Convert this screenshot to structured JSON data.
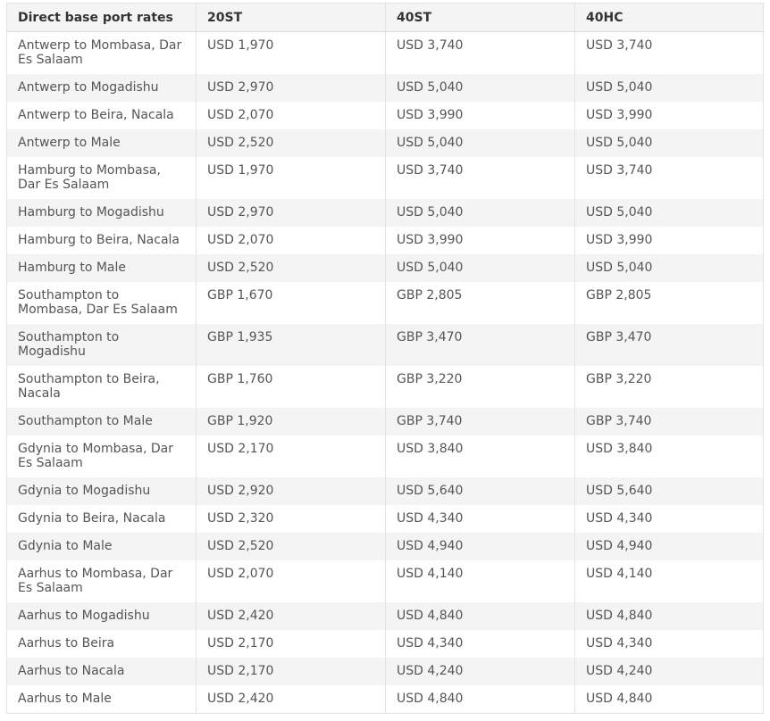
{
  "table": {
    "headers": [
      "Direct base port rates",
      "20ST",
      "40ST",
      "40HC"
    ],
    "rows": [
      [
        "Antwerp to Mombasa, Dar Es Salaam",
        "USD 1,970",
        "USD 3,740",
        "USD 3,740"
      ],
      [
        "Antwerp to Mogadishu",
        "USD 2,970",
        "USD 5,040",
        "USD 5,040"
      ],
      [
        "Antwerp to Beira, Nacala",
        "USD 2,070",
        "USD 3,990",
        "USD 3,990"
      ],
      [
        "Antwerp to Male",
        "USD 2,520",
        "USD 5,040",
        "USD 5,040"
      ],
      [
        "Hamburg to Mombasa, Dar Es Salaam",
        "USD 1,970",
        "USD 3,740",
        "USD 3,740"
      ],
      [
        "Hamburg to Mogadishu",
        "USD 2,970",
        "USD 5,040",
        "USD 5,040"
      ],
      [
        "Hamburg to Beira, Nacala",
        "USD 2,070",
        "USD 3,990",
        "USD 3,990"
      ],
      [
        "Hamburg to Male",
        "USD 2,520",
        "USD 5,040",
        "USD 5,040"
      ],
      [
        "Southampton to Mombasa, Dar Es Salaam",
        "GBP 1,670",
        "GBP 2,805",
        "GBP 2,805"
      ],
      [
        "Southampton to Mogadishu",
        "GBP 1,935",
        "GBP 3,470",
        "GBP 3,470"
      ],
      [
        "Southampton to Beira, Nacala",
        "GBP 1,760",
        "GBP 3,220",
        "GBP 3,220"
      ],
      [
        "Southampton to Male",
        "GBP 1,920",
        "GBP 3,740",
        "GBP 3,740"
      ],
      [
        "Gdynia to Mombasa, Dar Es Salaam",
        "USD 2,170",
        "USD 3,840",
        "USD 3,840"
      ],
      [
        "Gdynia to Mogadishu",
        "USD 2,920",
        "USD 5,640",
        "USD 5,640"
      ],
      [
        "Gdynia to Beira, Nacala",
        "USD 2,320",
        "USD 4,340",
        "USD 4,340"
      ],
      [
        "Gdynia to Male",
        "USD 2,520",
        "USD 4,940",
        "USD 4,940"
      ],
      [
        "Aarhus to Mombasa, Dar Es Salaam",
        "USD 2,070",
        "USD 4,140",
        "USD 4,140"
      ],
      [
        "Aarhus to Mogadishu",
        "USD 2,420",
        "USD 4,840",
        "USD 4,840"
      ],
      [
        "Aarhus to Beira",
        "USD 2,170",
        "USD 4,340",
        "USD 4,340"
      ],
      [
        "Aarhus to Nacala",
        "USD 2,170",
        "USD 4,240",
        "USD 4,240"
      ],
      [
        "Aarhus to Male",
        "USD 2,420",
        "USD 4,840",
        "USD 4,840"
      ]
    ]
  }
}
